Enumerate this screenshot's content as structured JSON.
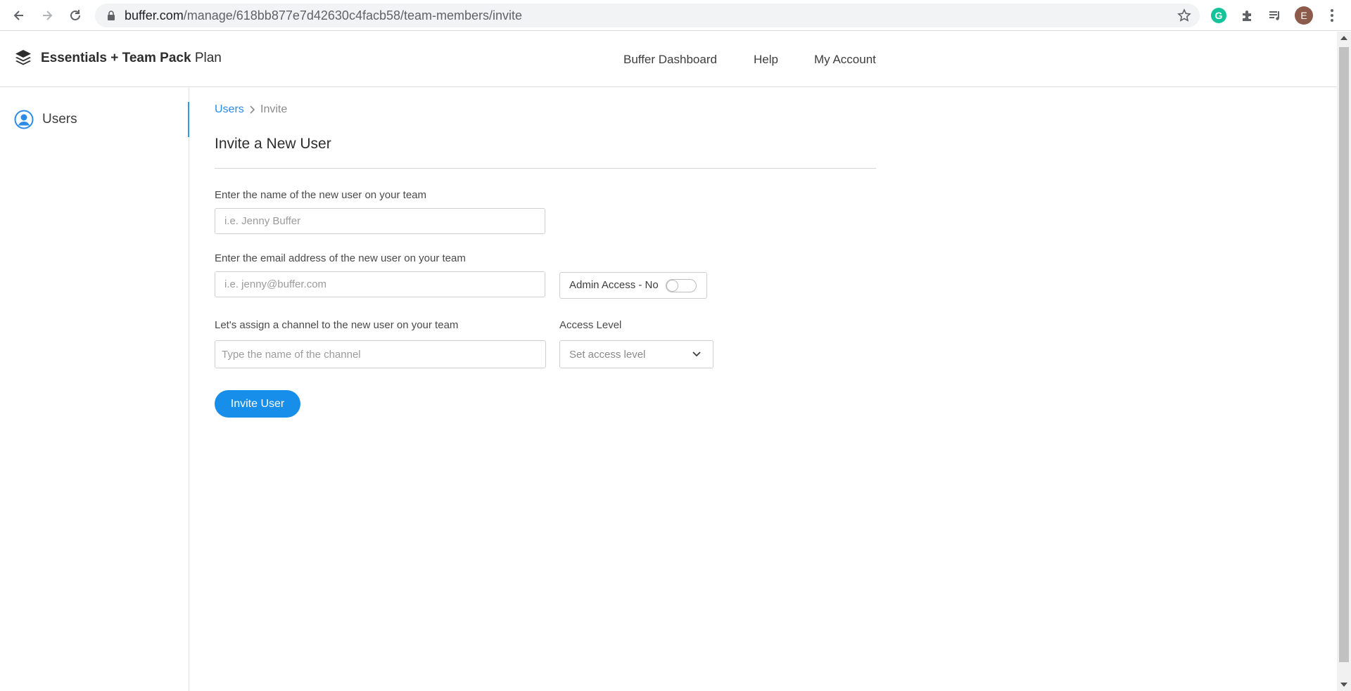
{
  "browser": {
    "url_host": "buffer.com",
    "url_path": "/manage/618bb877e7d42630c4facb58/team-members/invite",
    "grammarly_letter": "G",
    "profile_initial": "E"
  },
  "header": {
    "brand_bold": "Essentials + Team Pack",
    "brand_rest": "Plan",
    "nav": [
      "Buffer Dashboard",
      "Help",
      "My Account"
    ]
  },
  "sidebar": {
    "items": [
      {
        "label": "Users",
        "icon": "user-circle-icon",
        "active": true
      }
    ]
  },
  "breadcrumb": {
    "parent": "Users",
    "current": "Invite"
  },
  "page": {
    "title": "Invite a New User"
  },
  "form": {
    "name_label": "Enter the name of the new user on your team",
    "name_placeholder": "i.e. Jenny Buffer",
    "email_label": "Enter the email address of the new user on your team",
    "email_placeholder": "i.e. jenny@buffer.com",
    "admin_label": "Admin Access - No",
    "admin_on": false,
    "channel_label": "Let's assign a channel to the new user on your team",
    "channel_placeholder": "Type the name of the channel",
    "access_label": "Access Level",
    "access_value": "Set access level",
    "submit_label": "Invite User"
  },
  "colors": {
    "accent": "#168eea",
    "link": "#2c8be6",
    "active_border": "#2c9be6"
  }
}
